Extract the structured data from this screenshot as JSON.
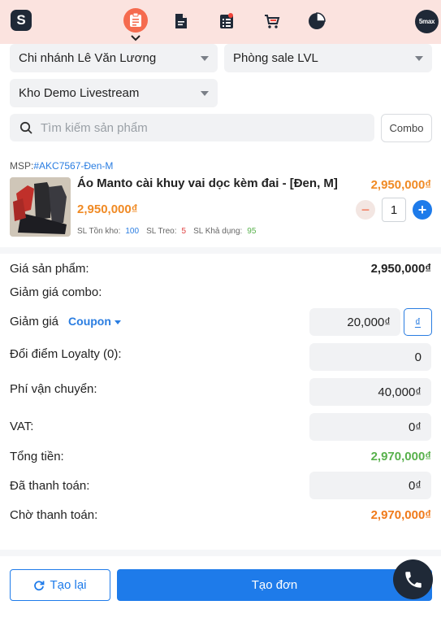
{
  "nav": {
    "logo_text": "S",
    "brand_badge": "5max",
    "items": [
      "order-clipboard-icon",
      "document-icon",
      "checklist-icon",
      "cart-icon",
      "pie-chart-icon"
    ]
  },
  "filters": {
    "branch": "Chi nhánh Lê Văn Lương",
    "department": "Phòng sale LVL",
    "warehouse": "Kho Demo Livestream"
  },
  "search": {
    "placeholder": "Tìm kiếm sản phẩm",
    "combo_label": "Combo"
  },
  "product": {
    "msp_label": "MSP:",
    "msp_code": "#AKC7567-Đen-M",
    "name": "Áo Manto cài khuy vai dọc kèm đai - [Đen, M]",
    "price": "2,950,000₫",
    "unit_price": "2,950,000₫",
    "quantity": "1",
    "stock_label": "SL Tồn kho:",
    "stock_value": "100",
    "hold_label": "SL Treo:",
    "hold_value": "5",
    "available_label": "SL Khả dụng:",
    "available_value": "95"
  },
  "summary": {
    "product_price_label": "Giá sản phẩm:",
    "product_price_value": "2,950,000₫",
    "combo_discount_label": "Giảm giá combo:",
    "discount_label": "Giảm giá",
    "coupon_label": "Coupon",
    "discount_value": "20,000₫",
    "discount_unit": "₫",
    "loyalty_label": "Đổi điểm Loyalty (0):",
    "loyalty_value": "0",
    "shipping_label": "Phí vận chuyển:",
    "shipping_value": "40,000₫",
    "vat_label": "VAT:",
    "vat_value": "0₫",
    "total_label": "Tổng tiền:",
    "total_value": "2,970,000₫",
    "paid_label": "Đã thanh toán:",
    "paid_value": "0₫",
    "pending_label": "Chờ thanh toán:",
    "pending_value": "2,970,000₫"
  },
  "actions": {
    "reload_label": "Tạo lại",
    "create_label": "Tạo đơn"
  },
  "colors": {
    "accent": "#1e7bea",
    "price_orange": "#f08a24",
    "total_green": "#58b14c",
    "pending_orange": "#f07a1a",
    "topbar_bg": "#fbe3df"
  }
}
